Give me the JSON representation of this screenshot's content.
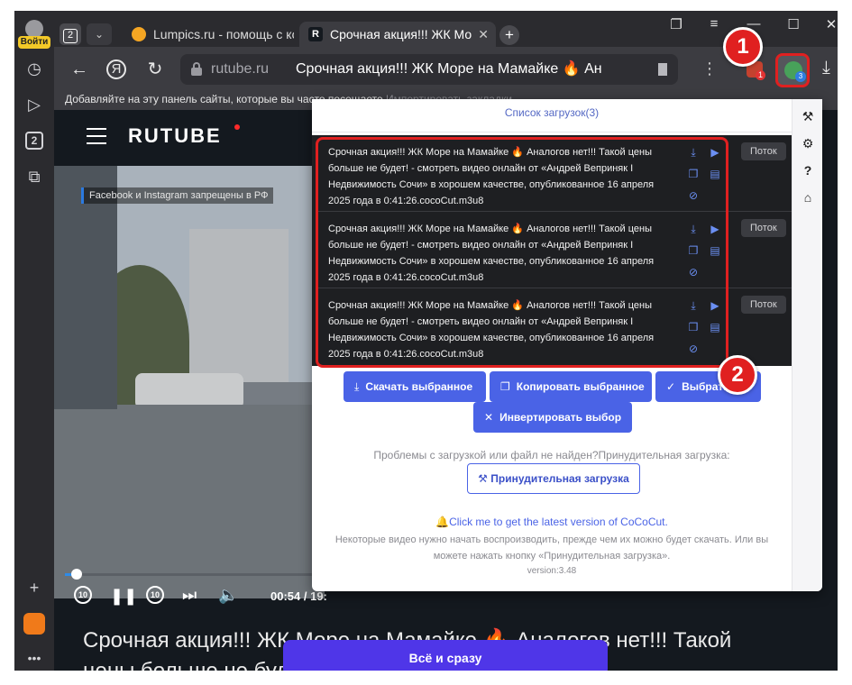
{
  "left_rail": {
    "login_label": "Войти",
    "tabs_count": "2"
  },
  "tabs": {
    "count": "2",
    "items": [
      {
        "label": "Lumpics.ru - помощь с ком"
      },
      {
        "label": "Срочная акция!!! ЖК Мо"
      }
    ],
    "close_glyph": "✕",
    "new_tab_glyph": "+"
  },
  "address_bar": {
    "domain": "rutube.ru",
    "page_title": "Срочная акция!!! ЖК Море на Мамайке 🔥 Ан",
    "yandex_glyph": "Я"
  },
  "extensions": {
    "ext1_badge": "1",
    "cococut_badge": "3"
  },
  "bookmarks_bar": {
    "hint": "Добавляйте на эту панель сайты, которые вы часто посещаете",
    "import_link": "Импортировать закладки"
  },
  "rutube": {
    "logo": "RUTUBE",
    "notice": "Facebook и Instagram запрещены в РФ",
    "rewind_label": "10",
    "forward_label": "10",
    "timecode": "00:54 / 19:",
    "progress_fraction": 0.046,
    "video_title": "Срочная акция!!! ЖК Море на Мамайке 🔥 Аналогов нет!!! Такой цены больше не будет",
    "cta_label": "Всё и сразу"
  },
  "popup": {
    "header": "Список загрузок(3)",
    "downloads": [
      {
        "text": "Срочная акция!!! ЖК Море на Мамайке 🔥 Аналогов нет!!! Такой цены больше не будет! - смотреть видео онлайн от «Андрей Веприняк I Недвижимость Сочи» в хорошем качестве, опубликованное 16 апреля 2025 года в 0:41:26.cocoCut.m3u8",
        "flow_label": "Поток"
      },
      {
        "text": "Срочная акция!!! ЖК Море на Мамайке 🔥 Аналогов нет!!! Такой цены больше не будет! - смотреть видео онлайн от «Андрей Веприняк I Недвижимость Сочи» в хорошем качестве, опубликованное 16 апреля 2025 года в 0:41:26.cocoCut.m3u8",
        "flow_label": "Поток"
      },
      {
        "text": "Срочная акция!!! ЖК Море на Мамайке 🔥 Аналогов нет!!! Такой цены больше не будет! - смотреть видео онлайн от «Андрей Веприняк I Недвижимость Сочи» в хорошем качестве, опубликованное 16 апреля 2025 года в 0:41:26.cocoCut.m3u8",
        "flow_label": "Поток"
      }
    ],
    "buttons": {
      "download_selected": "Скачать выбранное",
      "copy_selected": "Копировать выбранное",
      "select_all": "Выбрать",
      "invert_selection": "Инвертировать выбор"
    },
    "problem_text": "Проблемы с загрузкой или файл не найден?Принудительная загрузка:",
    "force_download": "Принудительная загрузка",
    "latest_version_link": "Click me to get the latest version of CoCoCut.",
    "hint": "Некоторые видео нужно начать воспроизводить, прежде чем их можно будет скачать. Или вы можете нажать кнопку «Принудительная загрузка».",
    "version": "version:3.48"
  },
  "annotations": {
    "step1": "1",
    "step2": "2",
    "color": "#e02020"
  },
  "colors": {
    "accent": "#4a63e6",
    "page_bg": "#14191f",
    "cta": "#4f36e8"
  }
}
